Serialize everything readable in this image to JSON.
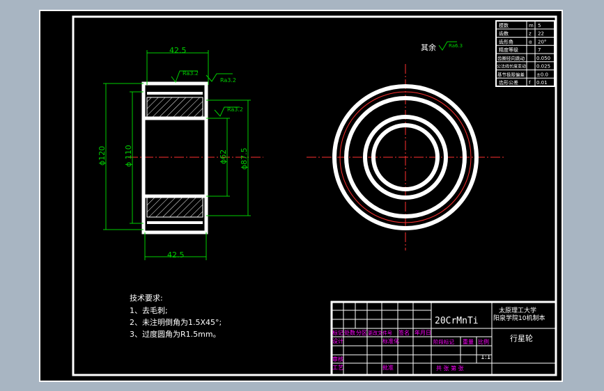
{
  "drawing": {
    "other_surfaces_label": "其余",
    "roughness_main": "Ra6.3",
    "roughness_marks": [
      "Ra3.2",
      "Ra3.2",
      "Ra3.2"
    ],
    "dimensions": {
      "width_top": "42.5",
      "width_bottom": "42.5",
      "dia_outer": "ϕ120",
      "dia_root": "ϕ 110",
      "dia_bore": "ϕ62",
      "dia_mid": "ϕ87.5"
    },
    "tech_requirements": {
      "title": "技术要求:",
      "items": [
        "1、去毛刺;",
        "2、未注明倒角为1.5X45°;",
        "3、过度圆角为R1.5mm。"
      ]
    }
  },
  "param_table": {
    "rows": [
      {
        "name": "模数",
        "sym": "m",
        "val": "5"
      },
      {
        "name": "齿数",
        "sym": "z",
        "val": "22"
      },
      {
        "name": "齿形角",
        "sym": "α",
        "val": "20°"
      },
      {
        "name": "精度等级",
        "sym": "",
        "val": "7"
      },
      {
        "name": "齿圈径向跳动",
        "sym": "",
        "val": "0.050"
      },
      {
        "name": "公法线长度变动",
        "sym": "",
        "val": "0.025"
      },
      {
        "name": "基节极限偏差",
        "sym": "",
        "val": "±0.0"
      },
      {
        "name": "齿形公差",
        "sym": "f",
        "val": "0.01"
      }
    ]
  },
  "title_block": {
    "material": "20CrMnTi",
    "school_line1": "太原理工大学",
    "school_line2": "阳泉学院10机制本",
    "part_name": "行星轮",
    "header_cells": [
      "标记",
      "处数",
      "分区",
      "更改文件号",
      "签名",
      "年月日"
    ],
    "row_design": "设计",
    "row_standard": "标准化",
    "row_review": "审核",
    "row_process": "工艺",
    "row_approve": "批准",
    "stage_headers": [
      "阶段标记",
      "重量",
      "比例"
    ],
    "scale": "1:1",
    "sheet_text": "共  张 第  张"
  }
}
